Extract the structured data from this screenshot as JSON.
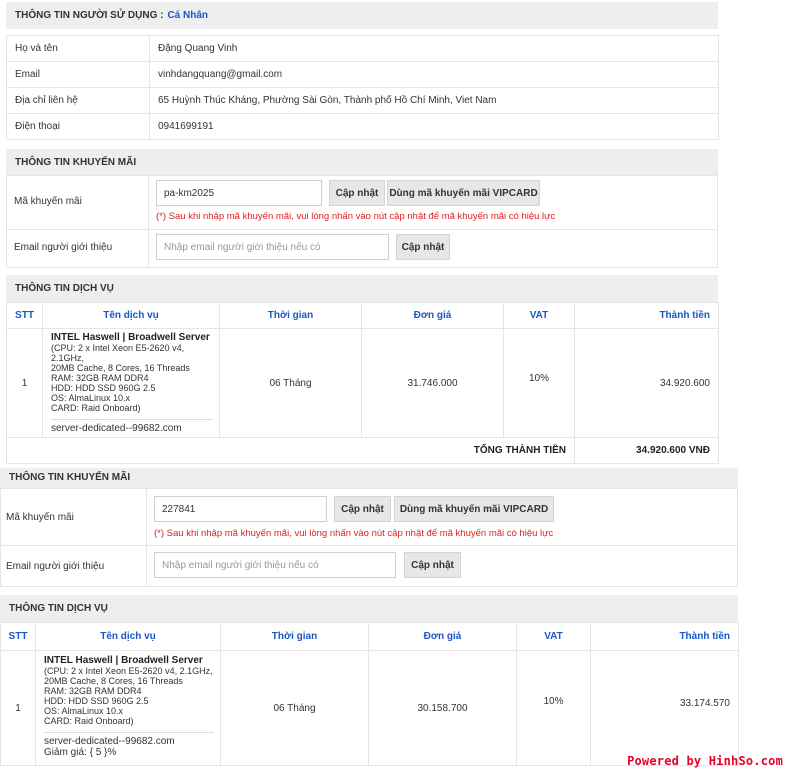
{
  "user_section": {
    "title": "THÔNG TIN NGƯỜI SỬ DỤNG :",
    "account_type": "Cá Nhân",
    "rows": [
      {
        "label": "Họ và tên",
        "value": "Đặng Quang Vinh"
      },
      {
        "label": "Email",
        "value": "vinhdangquang@gmail.com"
      },
      {
        "label": "Địa chỉ liên hệ",
        "value": "65 Huỳnh Thúc Kháng, Phường Sài Gòn, Thành phố Hồ Chí Minh, Viet Nam"
      },
      {
        "label": "Điện thoại",
        "value": "0941699191"
      }
    ]
  },
  "promo_1": {
    "title": "THÔNG TIN KHUYẾN MÃI",
    "code_label": "Mã khuyến mãi",
    "code_value": "pa-km2025",
    "update_label": "Cập nhật",
    "vipcard_label": "Dùng mã khuyến mãi VIPCARD",
    "note": "(*) Sau khi nhập mã khuyến mãi, vui lòng nhấn vào nút cập nhật để mã khuyến mãi có hiệu lực",
    "referrer_label": "Email người giới thiệu",
    "referrer_placeholder": "Nhập email người giới thiệu nếu có",
    "referrer_update_label": "Cập nhật"
  },
  "service_1": {
    "title": "THÔNG TIN DỊCH VỤ",
    "headers": {
      "stt": "STT",
      "name": "Tên dịch vụ",
      "time": "Thời gian",
      "price": "Đơn giá",
      "vat": "VAT",
      "total": "Thành tiền"
    },
    "row": {
      "stt": "1",
      "product": "INTEL Haswell | Broadwell Server",
      "specs": [
        "(CPU: 2 x Intel Xeon E5-2620 v4, 2.1GHz,",
        "20MB Cache, 8 Cores, 16 Threads",
        "RAM: 32GB RAM DDR4",
        "HDD: HDD SSD 960G 2.5",
        "OS: AlmaLinux 10.x",
        "CARD: Raid Onboard)"
      ],
      "domain": "server-dedicated--99682.com",
      "time": "06 Tháng",
      "price": "31.746.000",
      "vat": "10%",
      "total": "34.920.600"
    },
    "grand_total_label": "TỔNG THÀNH TIỀN",
    "grand_total_value": "34.920.600 VNĐ"
  },
  "promo_2": {
    "title": "THÔNG TIN KHUYẾN MÃI",
    "code_label": "Mã khuyến mãi",
    "code_value": "227841",
    "update_label": "Cập nhật",
    "vipcard_label": "Dùng mã khuyến mãi VIPCARD",
    "note": "(*) Sau khi nhập mã khuyến mãi, vui lòng nhấn vào nút cập nhật để mã khuyến mãi có hiệu lực",
    "referrer_label": "Email người giới thiệu",
    "referrer_placeholder": "Nhập email người giới thiệu nếu có",
    "referrer_update_label": "Cập nhật"
  },
  "service_2": {
    "title": "THÔNG TIN DỊCH VỤ",
    "headers": {
      "stt": "STT",
      "name": "Tên dịch vụ",
      "time": "Thời gian",
      "price": "Đơn giá",
      "vat": "VAT",
      "total": "Thành tiền"
    },
    "row": {
      "stt": "1",
      "product": "INTEL Haswell | Broadwell Server",
      "specs": [
        "(CPU: 2 x Intel Xeon E5-2620 v4, 2.1GHz,",
        "20MB Cache, 8 Cores, 16 Threads",
        "RAM: 32GB RAM DDR4",
        "HDD: HDD SSD 960G 2.5",
        "OS: AlmaLinux 10.x",
        "CARD: Raid Onboard)"
      ],
      "domain": "server-dedicated--99682.com",
      "discount": "Giảm giá: { 5 }%",
      "time": "06 Tháng",
      "price": "30.158.700",
      "vat": "10%",
      "total": "33.174.570"
    }
  },
  "watermark": "Powered by HinhSo.com",
  "colors": {
    "accent": "#1a57c6",
    "note_red": "#e02020",
    "header_bg": "#eeeeee",
    "watermark": "#e4002b"
  }
}
